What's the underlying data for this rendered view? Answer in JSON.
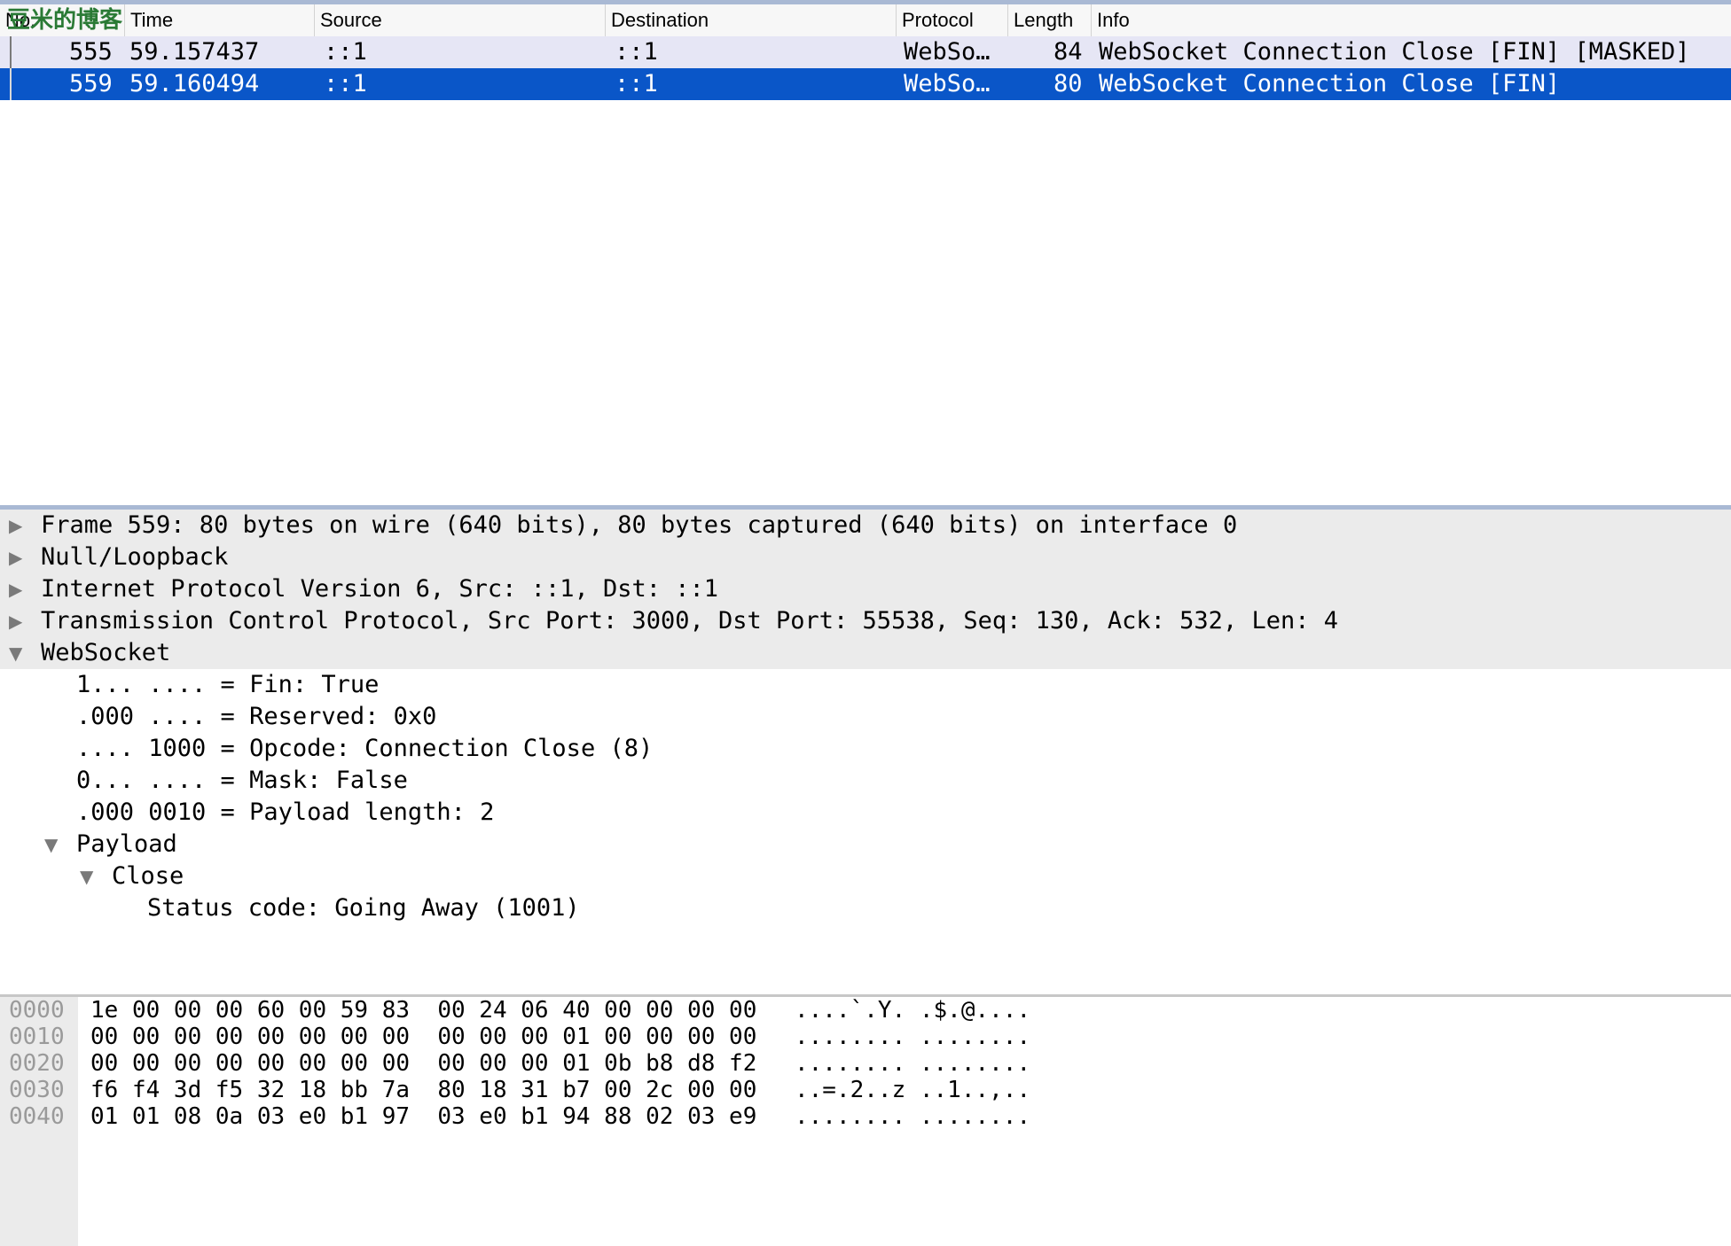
{
  "watermark": "豆米的博客",
  "packet_list": {
    "columns": [
      "No.",
      "Time",
      "Source",
      "Destination",
      "Protocol",
      "Length",
      "Info"
    ],
    "rows": [
      {
        "no": "555",
        "time": "59.157437",
        "source": "::1",
        "destination": "::1",
        "protocol": "WebSo…",
        "length": "84",
        "info": "WebSocket Connection Close [FIN] [MASKED]",
        "selected": false
      },
      {
        "no": "559",
        "time": "59.160494",
        "source": "::1",
        "destination": "::1",
        "protocol": "WebSo…",
        "length": "80",
        "info": "WebSocket Connection Close [FIN]",
        "selected": true
      }
    ]
  },
  "details": {
    "collapsed_icon": "▶",
    "expanded_icon": "▼",
    "frame": "Frame 559: 80 bytes on wire (640 bits), 80 bytes captured (640 bits) on interface 0",
    "null_loopback": "Null/Loopback",
    "ipv6": "Internet Protocol Version 6, Src: ::1, Dst: ::1",
    "tcp": "Transmission Control Protocol, Src Port: 3000, Dst Port: 55538, Seq: 130, Ack: 532, Len: 4",
    "websocket": "WebSocket",
    "fields": [
      "1... .... = Fin: True",
      ".000 .... = Reserved: 0x0",
      ".... 1000 = Opcode: Connection Close (8)",
      "0... .... = Mask: False",
      ".000 0010 = Payload length: 2"
    ],
    "payload": "Payload",
    "close": "Close",
    "status_code": "Status code: Going Away (1001)"
  },
  "bytes": [
    {
      "offset": "0000",
      "hex": "1e 00 00 00 60 00 59 83  00 24 06 40 00 00 00 00",
      "ascii": "....`.Y. .$.@...."
    },
    {
      "offset": "0010",
      "hex": "00 00 00 00 00 00 00 00  00 00 00 01 00 00 00 00",
      "ascii": "........ ........"
    },
    {
      "offset": "0020",
      "hex": "00 00 00 00 00 00 00 00  00 00 00 01 0b b8 d8 f2",
      "ascii": "........ ........"
    },
    {
      "offset": "0030",
      "hex": "f6 f4 3d f5 32 18 bb 7a  80 18 31 b7 00 2c 00 00",
      "ascii": "..=.2..z ..1..,.."
    },
    {
      "offset": "0040",
      "hex": "01 01 08 0a 03 e0 b1 97  03 e0 b1 94 88 02 03 e9",
      "ascii": "........ ........"
    }
  ]
}
